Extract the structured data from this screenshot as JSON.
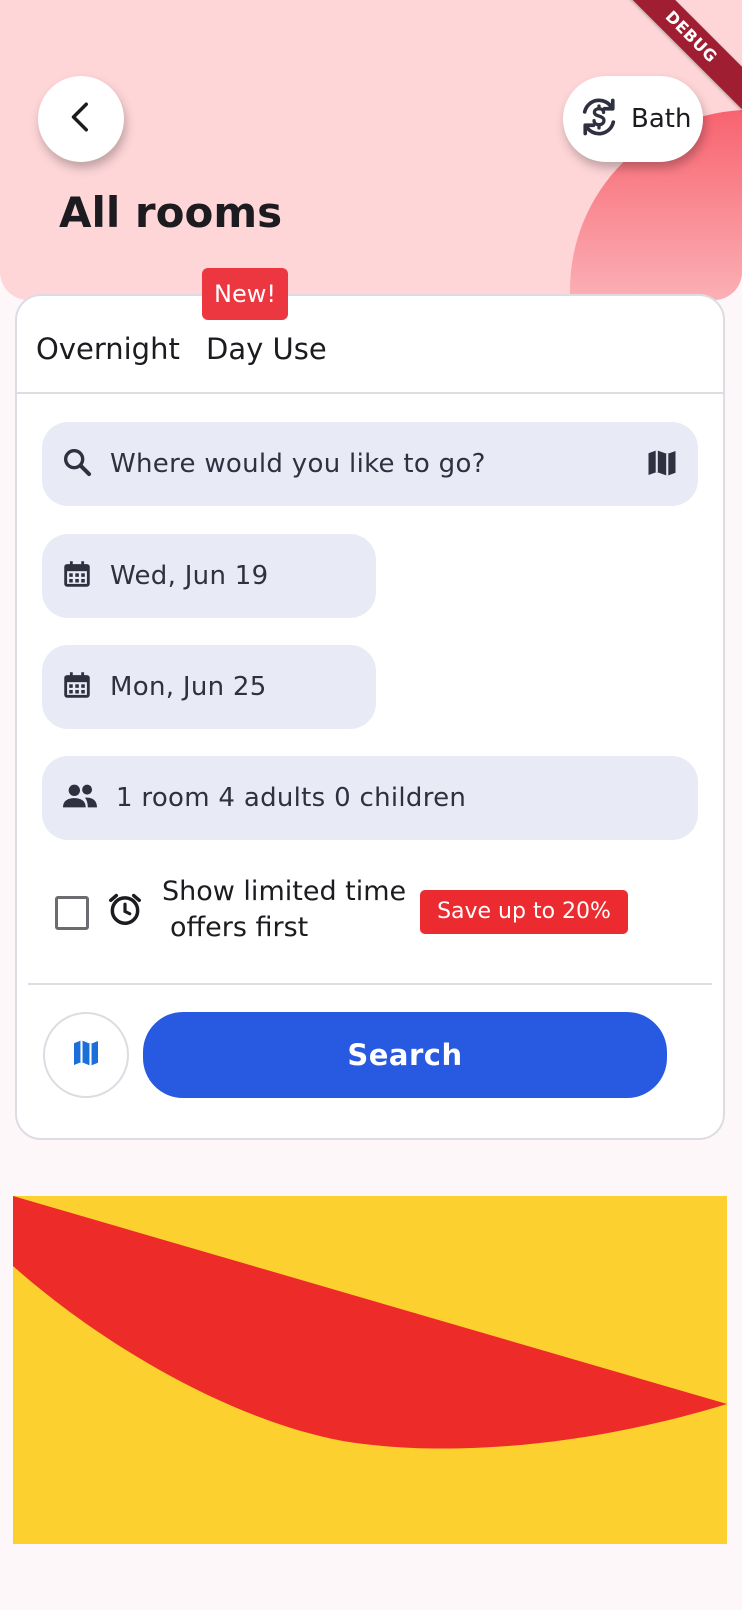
{
  "header": {
    "title": "All rooms",
    "currency_label": "Bath",
    "debug_label": "DEBUG"
  },
  "tabs": {
    "overnight": "Overnight",
    "day_use": "Day Use",
    "day_use_badge": "New!"
  },
  "search": {
    "placeholder": "Where would you like to go?"
  },
  "dates": {
    "check_in": "Wed, Jun 19",
    "check_out": "Mon, Jun 25"
  },
  "guests": {
    "summary": "1 room 4 adults 0 children"
  },
  "offers": {
    "label_line1": "Show limited time",
    "label_line2": "offers first",
    "badge": "Save up to 20%",
    "checked": false
  },
  "actions": {
    "search_label": "Search"
  },
  "colors": {
    "accent": "#2759e1",
    "badge_red": "#ec3640",
    "header_pink": "#fed6d8",
    "banner_yellow": "#fcd02f",
    "banner_red": "#ed2b28"
  },
  "icons": [
    "back-icon",
    "currency-exchange-icon",
    "search-icon",
    "map-icon",
    "calendar-icon",
    "people-icon",
    "alarm-icon"
  ]
}
